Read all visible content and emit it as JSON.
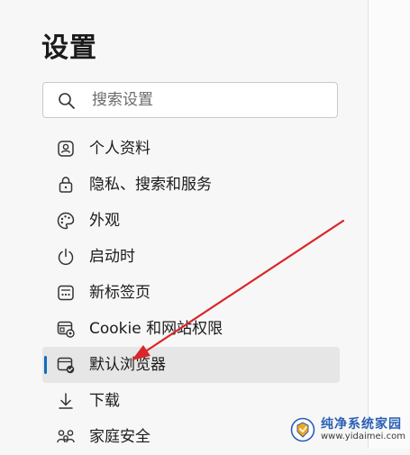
{
  "header": {
    "title": "设置"
  },
  "search": {
    "placeholder": "搜索设置"
  },
  "nav": {
    "items": [
      {
        "id": "profiles",
        "label": "个人资料",
        "icon": "profile-icon"
      },
      {
        "id": "privacy",
        "label": "隐私、搜索和服务",
        "icon": "lock-icon"
      },
      {
        "id": "appearance",
        "label": "外观",
        "icon": "palette-icon"
      },
      {
        "id": "startup",
        "label": "启动时",
        "icon": "power-icon"
      },
      {
        "id": "newtab",
        "label": "新标签页",
        "icon": "new-tab-icon"
      },
      {
        "id": "cookies",
        "label": "Cookie 和网站权限",
        "icon": "site-permissions-icon"
      },
      {
        "id": "default-browser",
        "label": "默认浏览器",
        "icon": "default-browser-icon",
        "selected": true
      },
      {
        "id": "downloads",
        "label": "下载",
        "icon": "download-icon"
      },
      {
        "id": "family",
        "label": "家庭安全",
        "icon": "family-icon"
      }
    ]
  },
  "colors": {
    "accent": "#0f6cbd",
    "annotation_arrow": "#d9262a",
    "selected_bg": "#e6e6e6"
  },
  "watermark": {
    "main": "纯净系统家园",
    "sub": "www.yidaimei.com"
  }
}
